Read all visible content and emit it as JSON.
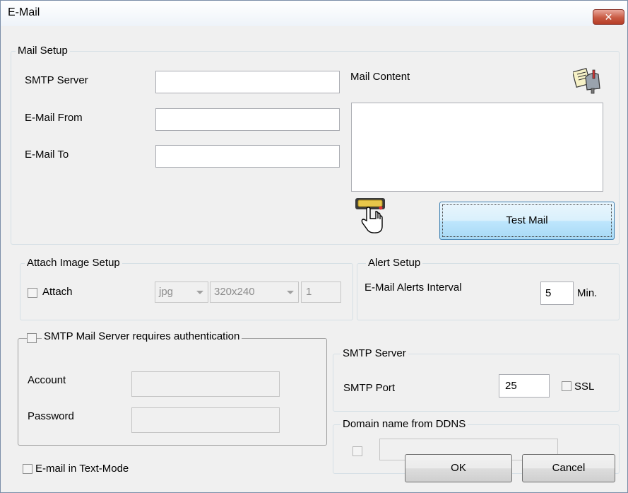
{
  "window": {
    "title": "E-Mail",
    "close_glyph": "✕"
  },
  "mail_setup": {
    "legend": "Mail Setup",
    "smtp_server_label": "SMTP Server",
    "smtp_server_value": "",
    "email_from_label": "E-Mail From",
    "email_from_value": "",
    "email_to_label": "E-Mail To",
    "email_to_value": "",
    "mail_content_label": "Mail Content",
    "mail_content_value": "",
    "test_mail_button": "Test Mail"
  },
  "attach_image_setup": {
    "legend": "Attach Image Setup",
    "attach_label": "Attach",
    "attach_checked": false,
    "format_value": "jpg",
    "resolution_value": "320x240",
    "count_value": "1"
  },
  "alert_setup": {
    "legend": "Alert Setup",
    "interval_label": "E-Mail Alerts Interval",
    "interval_value": "5",
    "unit_label": "Min."
  },
  "authentication": {
    "legend": "SMTP Mail Server requires authentication",
    "checked": false,
    "account_label": "Account",
    "account_value": "",
    "password_label": "Password",
    "password_value": ""
  },
  "smtp_server": {
    "legend": "SMTP Server",
    "port_label": "SMTP Port",
    "port_value": "25",
    "ssl_label": "SSL",
    "ssl_checked": false
  },
  "ddns": {
    "legend": "Domain name from DDNS",
    "checked": false,
    "value": ""
  },
  "footer": {
    "text_mode_label": "E-mail in Text-Mode",
    "text_mode_checked": false,
    "ok_button": "OK",
    "cancel_button": "Cancel"
  },
  "colors": {
    "close_button": "#c85a43",
    "focus_border": "#3c7fb1",
    "group_border": "#d5dfe5"
  }
}
